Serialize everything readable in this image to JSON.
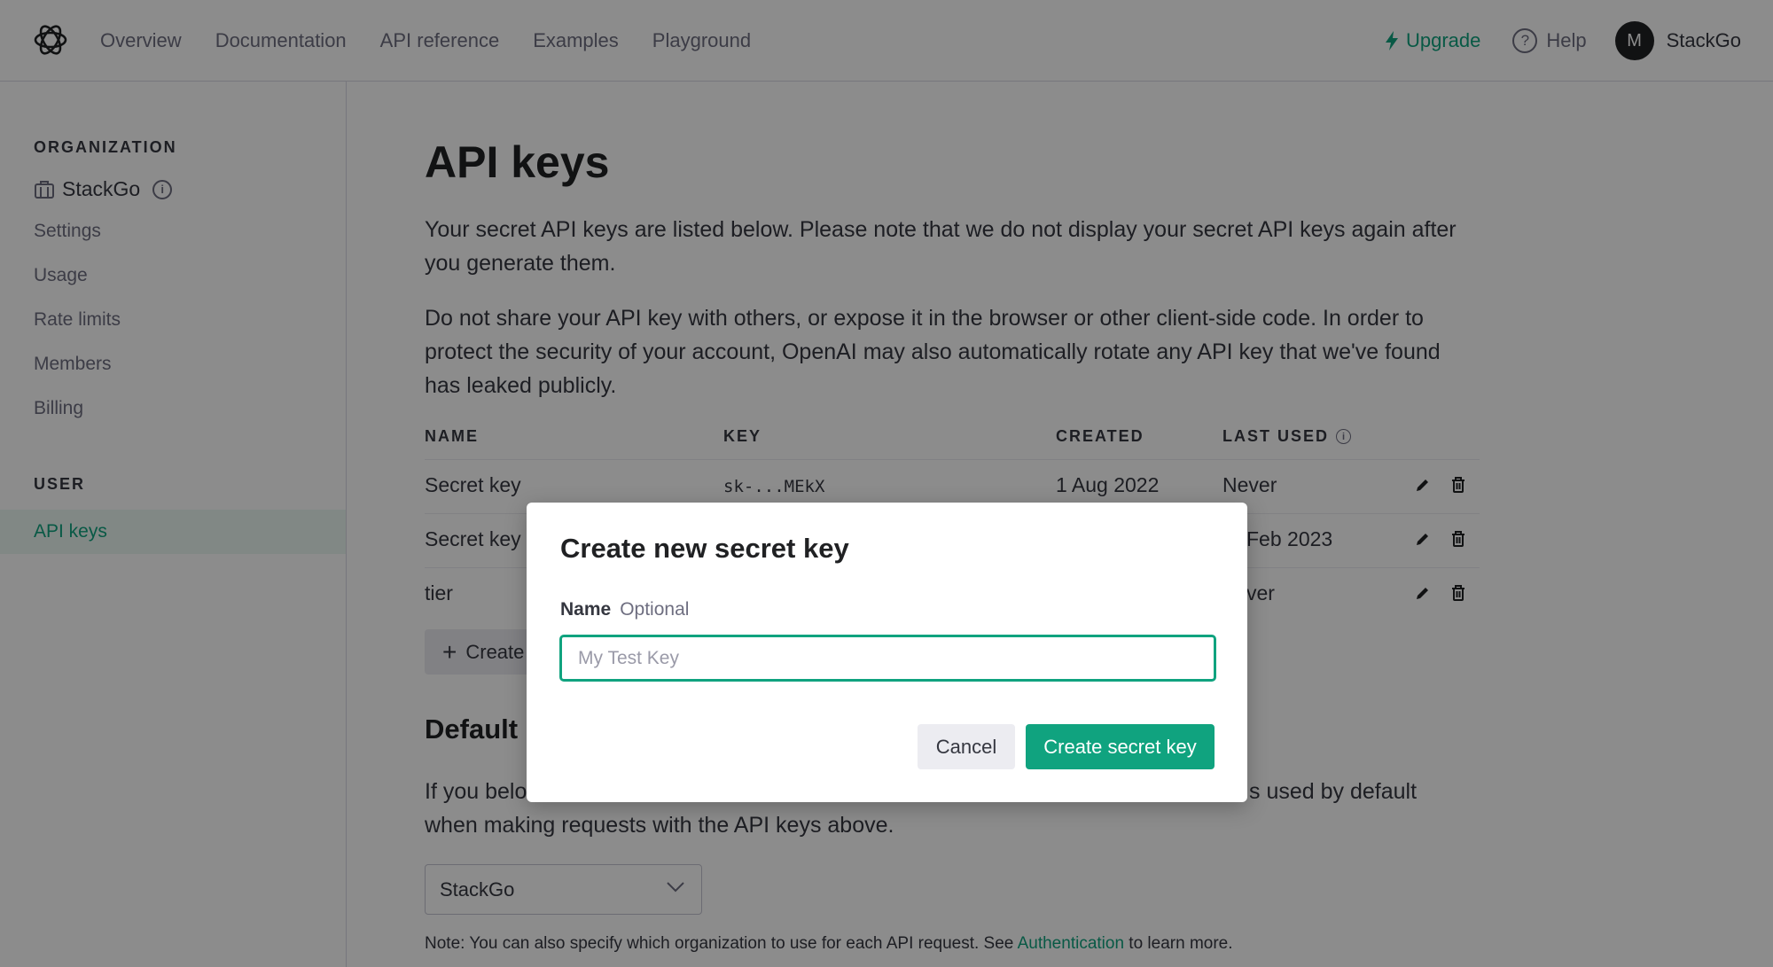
{
  "nav": {
    "links": [
      "Overview",
      "Documentation",
      "API reference",
      "Examples",
      "Playground"
    ],
    "upgrade_label": "Upgrade",
    "help_label": "Help",
    "avatar_initial": "M",
    "account_name": "StackGo"
  },
  "sidebar": {
    "org_heading": "ORGANIZATION",
    "org_name": "StackGo",
    "org_items": [
      "Settings",
      "Usage",
      "Rate limits",
      "Members",
      "Billing"
    ],
    "user_heading": "USER",
    "active_item": "API keys"
  },
  "main": {
    "title": "API keys",
    "intro": "Your secret API keys are listed below. Please note that we do not display your secret API keys again after you generate them.",
    "warning": "Do not share your API key with others, or expose it in the browser or other client-side code. In order to protect the security of your account, OpenAI may also automatically rotate any API key that we've found has leaked publicly.",
    "table": {
      "headers": [
        "NAME",
        "KEY",
        "CREATED",
        "LAST USED"
      ],
      "rows": [
        {
          "name": "Secret key",
          "key": "sk-...MEkX",
          "created": "1 Aug 2022",
          "last_used": "Never"
        },
        {
          "name": "Secret key",
          "key": "",
          "created": "",
          "last_used": "Feb 2023"
        },
        {
          "name": "tier",
          "key": "",
          "created": "",
          "last_used": "ver"
        }
      ]
    },
    "create_button": "Create",
    "default_org_title": "Default",
    "default_org_text_left": "If you belo",
    "default_org_text_right": "s used by default",
    "default_org_text_line2": "when making requests with the API keys above.",
    "org_select_value": "StackGo",
    "note_prefix": "Note: You can also specify which organization to use for each API request. See ",
    "note_link": "Authentication",
    "note_suffix": " to learn more."
  },
  "modal": {
    "title": "Create new secret key",
    "field_label": "Name",
    "field_optional": "Optional",
    "input_placeholder": "My Test Key",
    "input_value": "",
    "cancel_label": "Cancel",
    "create_label": "Create secret key"
  },
  "colors": {
    "accent": "#10a37f",
    "text": "#353740",
    "muted": "#6e6e80",
    "overlay": "rgba(0,0,0,0.45)"
  }
}
